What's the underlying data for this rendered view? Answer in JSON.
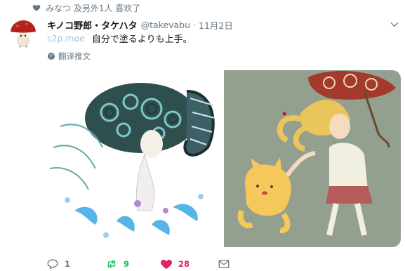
{
  "social_context": {
    "text": "みなつ 及另外1人 喜欢了",
    "icon": "heart-icon"
  },
  "tweet": {
    "display_name": "キノコ野郎・タケハタ",
    "handle": "@takevabu",
    "separator": "·",
    "date": "11月2日",
    "link": "s2p.moe",
    "text": "自分で塗るよりも上手。",
    "translate_label": "翻译推文"
  },
  "actions": {
    "reply": {
      "icon": "reply-icon",
      "count": "1"
    },
    "retweet": {
      "icon": "retweet-icon",
      "count": "9",
      "color": "#17bf63"
    },
    "like": {
      "icon": "heart-filled-icon",
      "count": "28",
      "color": "#e0245e"
    },
    "message": {
      "icon": "envelope-icon"
    }
  },
  "colors": {
    "muted": "#657786",
    "link": "#a7c4da",
    "retweet": "#17bf63",
    "like": "#e0245e"
  }
}
